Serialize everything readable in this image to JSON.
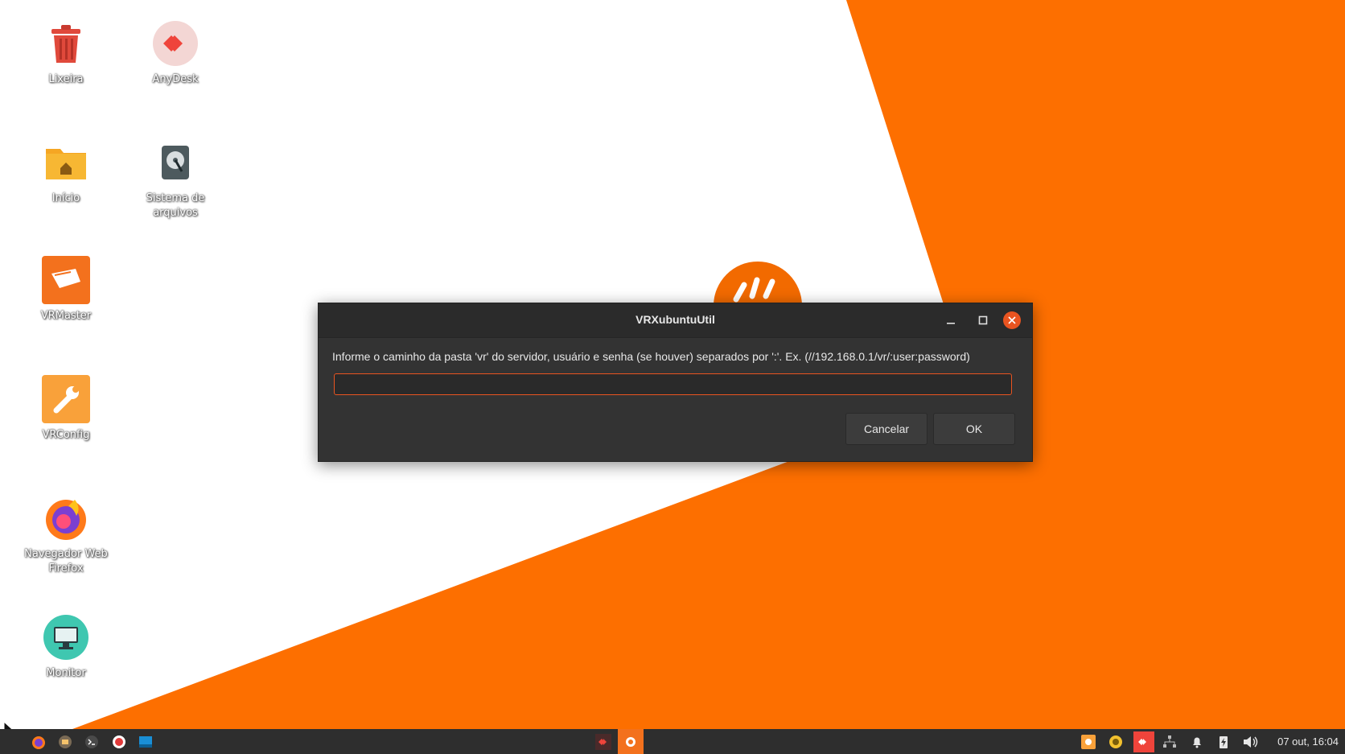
{
  "desktop": {
    "icons": [
      {
        "label": "Lixeira"
      },
      {
        "label": "AnyDesk"
      },
      {
        "label": "Início"
      },
      {
        "label": "Sistema de arquivos"
      },
      {
        "label": "VRMaster"
      },
      {
        "label": "VRConfig"
      },
      {
        "label": "Navegador Web Firefox"
      },
      {
        "label": "Monitor"
      }
    ]
  },
  "dialog": {
    "title": "VRXubuntuUtil",
    "prompt": "Informe o caminho da pasta 'vr' do servidor, usuário e senha (se houver) separados por ':'. Ex. (//192.168.0.1/vr/:user:password)",
    "input_value": "",
    "cancel_label": "Cancelar",
    "ok_label": "OK"
  },
  "taskbar": {
    "clock": "07 out, 16:04"
  },
  "colors": {
    "accent": "#e95420",
    "wallpaper_orange": "#fd6f00",
    "dialog_bg": "#333333",
    "taskbar_bg": "#2e2e2e"
  }
}
